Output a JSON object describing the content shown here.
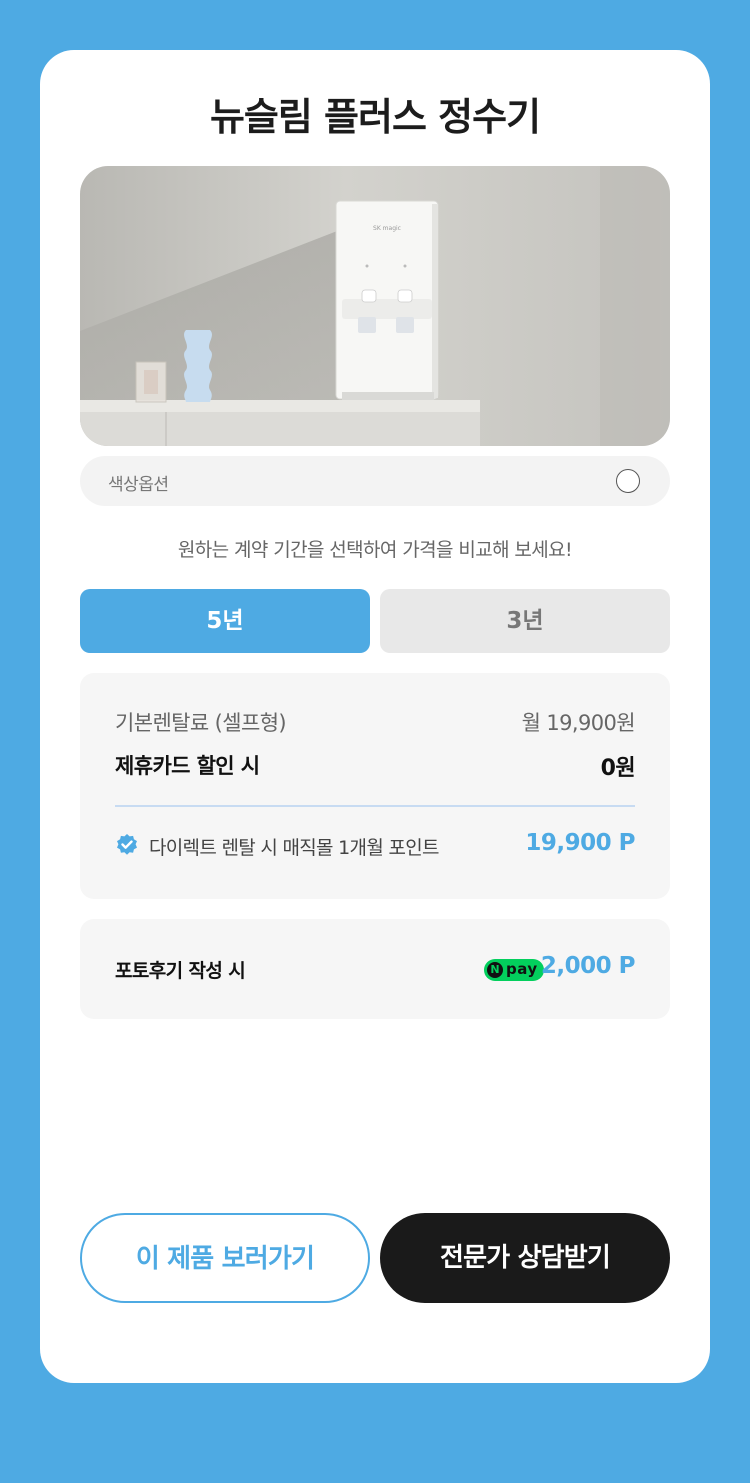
{
  "product": {
    "title": "뉴슬림 플러스 정수기",
    "image_icon": "water-purifier-image"
  },
  "color_option": {
    "label": "색상옵션",
    "swatch_color": "#ffffff"
  },
  "contract": {
    "hint": "원하는 계약 기간을 선택하여 가격을 비교해 보세요!",
    "tabs": [
      {
        "label": "5년",
        "selected": true
      },
      {
        "label": "3년",
        "selected": false
      }
    ]
  },
  "pricing": {
    "base_label": "기본렌탈료 (셀프형)",
    "base_value": "월 19,900원",
    "card_label": "제휴카드 할인 시",
    "card_value": "0원",
    "point_icon": "verified-check-icon",
    "point_label": "다이렉트 렌탈 시 매직몰 1개월 포인트",
    "point_value": "19,900 P"
  },
  "review": {
    "label": "포토후기 작성 시",
    "badge_n": "N",
    "badge_pay": "pay",
    "value": "2,000 P"
  },
  "actions": {
    "view_label": "이 제품 보러가기",
    "consult_label": "전문가 상담받기"
  },
  "colors": {
    "background": "#4eaae3",
    "accent": "#4eaae3",
    "dark_button": "#1a1a1a",
    "npay_green": "#03cf5d"
  }
}
